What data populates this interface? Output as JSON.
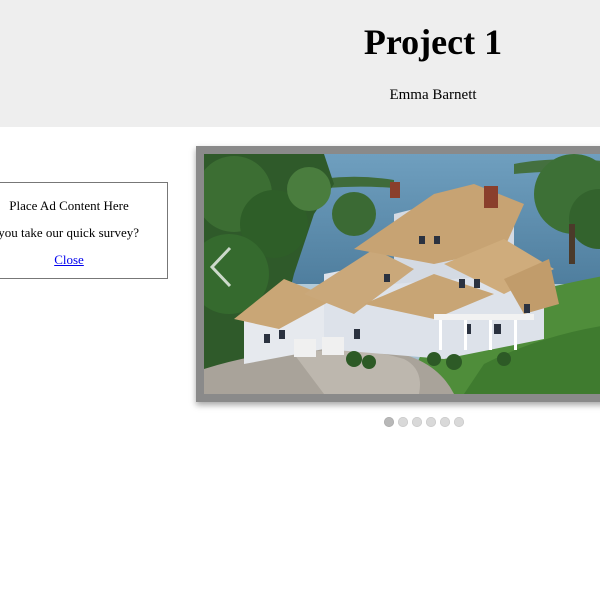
{
  "header": {
    "title": "Project 1",
    "author": "Emma Barnett"
  },
  "ad": {
    "line1": "Place Ad Content Here",
    "line2": "ll you take our quick survey?",
    "close_label": "Close"
  },
  "slider": {
    "image_icon": "house-aerial-photo",
    "prev_icon": "chevron-left-icon",
    "slide_count": 6,
    "active_index": 0
  },
  "colors": {
    "header_bg": "#eeeeee",
    "frame": "#8a8a8a",
    "link": "#0000ee"
  }
}
